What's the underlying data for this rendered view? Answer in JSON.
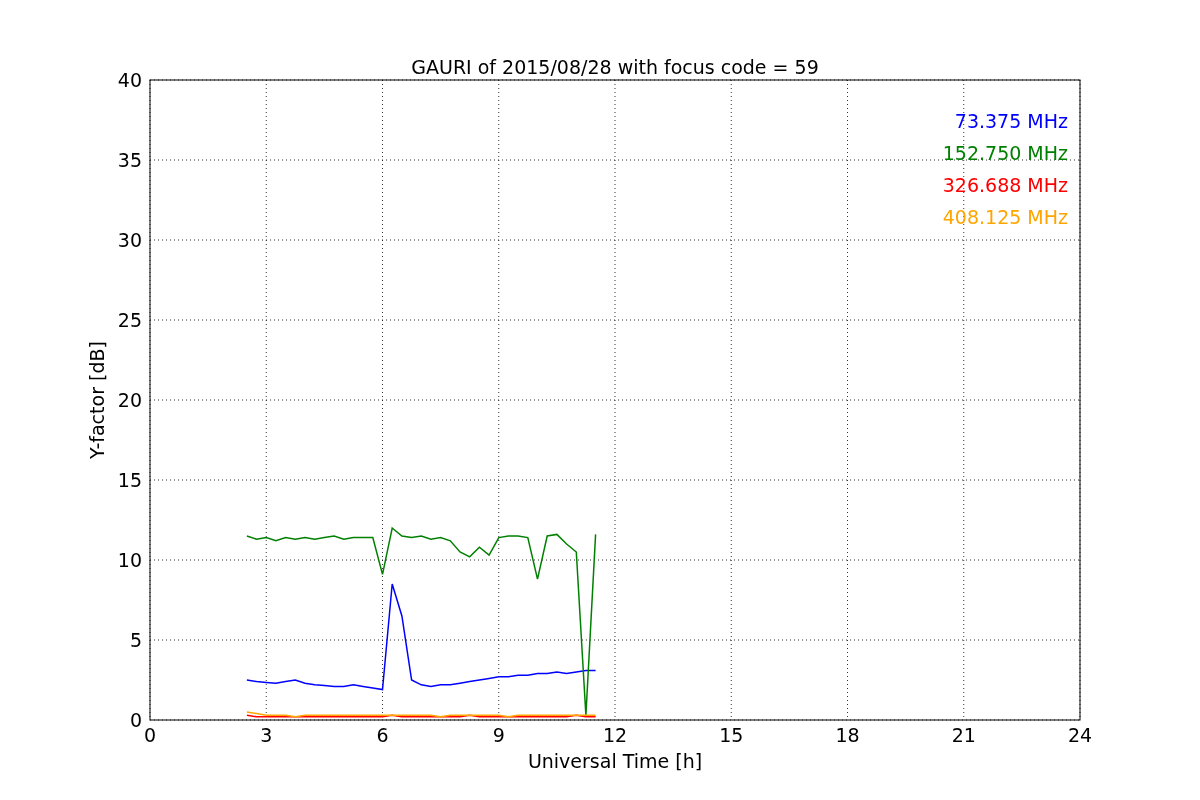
{
  "figure": {
    "chart_data": {
      "type": "line",
      "title": "GAURI of 2015/08/28 with focus code = 59",
      "xlabel": "Universal Time [h]",
      "ylabel": "Y-factor [dB]",
      "x": [
        2.5,
        2.75,
        3,
        3.25,
        3.5,
        3.75,
        4,
        4.25,
        4.5,
        4.75,
        5,
        5.25,
        5.5,
        5.75,
        6,
        6.25,
        6.5,
        6.75,
        7,
        7.25,
        7.5,
        7.75,
        8,
        8.25,
        8.5,
        8.75,
        9,
        9.25,
        9.5,
        9.75,
        10,
        10.25,
        10.5,
        10.75,
        11,
        11.25,
        11.5
      ],
      "series": [
        {
          "name": "73.375 MHz",
          "color": "#0000ff",
          "values": [
            2.5,
            2.4,
            2.35,
            2.3,
            2.4,
            2.5,
            2.3,
            2.2,
            2.15,
            2.1,
            2.1,
            2.2,
            2.1,
            2.0,
            1.9,
            8.5,
            6.5,
            2.5,
            2.2,
            2.1,
            2.2,
            2.2,
            2.3,
            2.4,
            2.5,
            2.6,
            2.7,
            2.7,
            2.8,
            2.8,
            2.9,
            2.9,
            3.0,
            2.9,
            3.0,
            3.1,
            3.1
          ]
        },
        {
          "name": "152.750 MHz",
          "color": "#008000",
          "values": [
            11.5,
            11.3,
            11.4,
            11.2,
            11.4,
            11.3,
            11.4,
            11.3,
            11.4,
            11.5,
            11.3,
            11.4,
            11.4,
            11.4,
            9.1,
            12.0,
            11.5,
            11.4,
            11.5,
            11.3,
            11.4,
            11.2,
            10.5,
            10.2,
            10.8,
            10.3,
            11.4,
            11.5,
            11.5,
            11.4,
            8.8,
            11.5,
            11.6,
            11.0,
            10.5,
            0.3,
            11.6
          ]
        },
        {
          "name": "326.688 MHz",
          "color": "#ff0000",
          "values": [
            0.3,
            0.2,
            0.2,
            0.2,
            0.2,
            0.2,
            0.2,
            0.2,
            0.2,
            0.2,
            0.2,
            0.2,
            0.2,
            0.2,
            0.2,
            0.3,
            0.2,
            0.2,
            0.2,
            0.2,
            0.2,
            0.2,
            0.2,
            0.3,
            0.2,
            0.2,
            0.2,
            0.2,
            0.2,
            0.2,
            0.2,
            0.2,
            0.2,
            0.2,
            0.3,
            0.2,
            0.2
          ]
        },
        {
          "name": "408.125 MHz",
          "color": "#ffa500",
          "values": [
            0.5,
            0.4,
            0.3,
            0.3,
            0.3,
            0.2,
            0.3,
            0.3,
            0.3,
            0.3,
            0.3,
            0.3,
            0.3,
            0.3,
            0.3,
            0.3,
            0.3,
            0.3,
            0.3,
            0.3,
            0.2,
            0.3,
            0.3,
            0.3,
            0.3,
            0.3,
            0.3,
            0.2,
            0.3,
            0.3,
            0.3,
            0.3,
            0.3,
            0.3,
            0.3,
            0.3,
            0.3
          ]
        }
      ],
      "grid": true,
      "xlim": [
        0,
        24
      ],
      "ylim": [
        0,
        40
      ],
      "xticks": [
        0,
        3,
        6,
        9,
        12,
        15,
        18,
        21,
        24
      ],
      "yticks": [
        0,
        5,
        10,
        15,
        20,
        25,
        30,
        35,
        40
      ]
    }
  }
}
